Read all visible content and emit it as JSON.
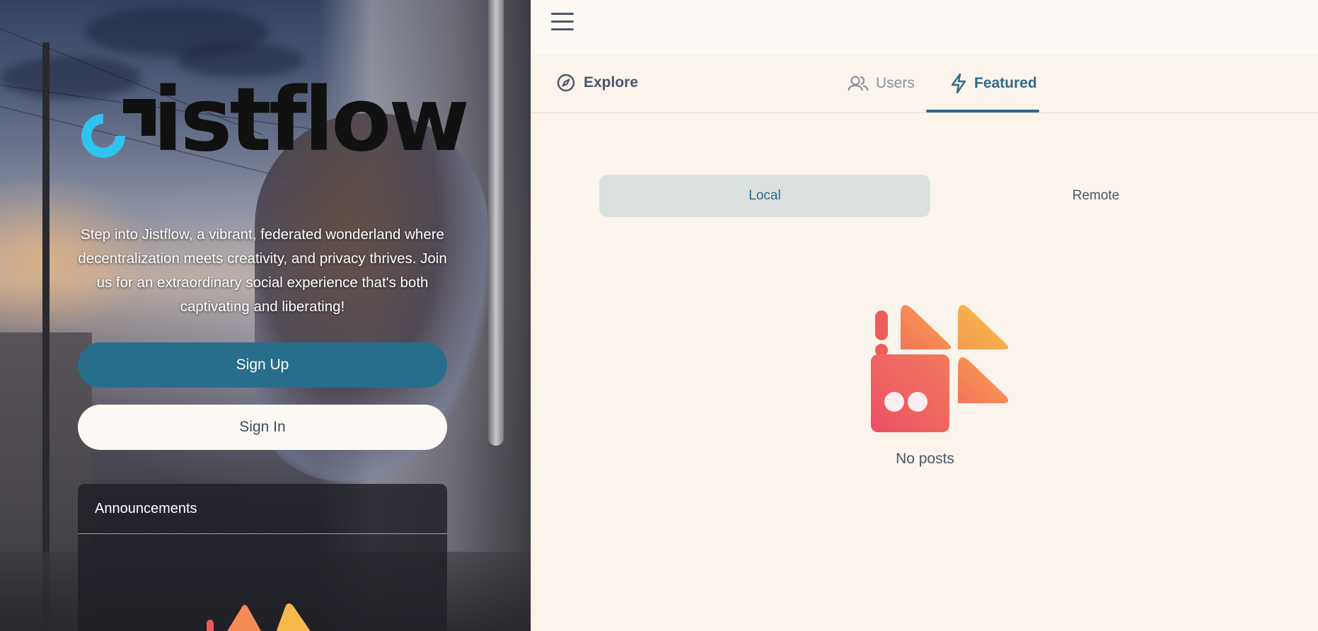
{
  "brand": {
    "logo_text": "Jistflow"
  },
  "hero": {
    "tagline": "Step into Jistflow, a vibrant, federated wonderland where decentralization meets creativity, and privacy thrives. Join us for an extraordinary social experience that's both captivating and liberating!",
    "signup_label": "Sign Up",
    "signin_label": "Sign In"
  },
  "announcements": {
    "title": "Announcements"
  },
  "header": {
    "menu_icon": "hamburger-menu-icon"
  },
  "tabs": {
    "explore_label": "Explore",
    "users_label": "Users",
    "featured_label": "Featured",
    "active": "Featured"
  },
  "segment": {
    "local_label": "Local",
    "remote_label": "Remote",
    "selected": "Local"
  },
  "empty_state": {
    "text": "No posts"
  },
  "colors": {
    "accent": "#276e8c",
    "accent_text": "#2f6b86",
    "logo_ring": "#2fc3f0",
    "empty_art_red": "#ec4f66",
    "empty_art_orange": "#f58a55",
    "empty_art_yellow": "#f7b94b"
  }
}
